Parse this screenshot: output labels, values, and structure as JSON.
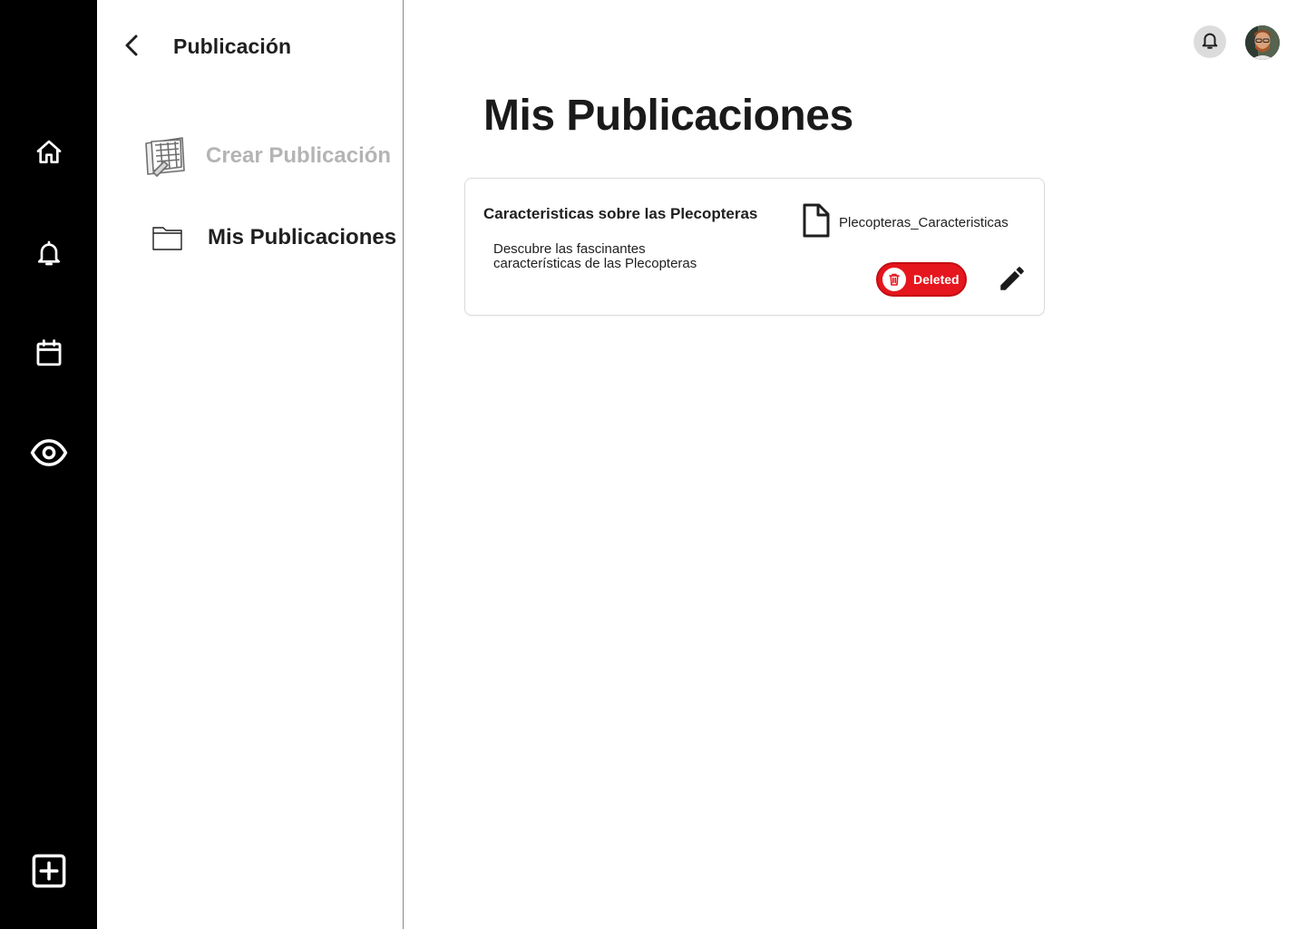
{
  "rail": {
    "items": [
      {
        "icon": "home-icon"
      },
      {
        "icon": "bell-icon"
      },
      {
        "icon": "calendar-icon"
      },
      {
        "icon": "eye-icon"
      }
    ],
    "add_icon": "plus-square-icon"
  },
  "panel": {
    "title": "Publicación",
    "nav": [
      {
        "label": "Crear Publicación",
        "icon": "create-publication-icon",
        "active": false
      },
      {
        "label": "Mis Publicaciones",
        "icon": "folder-icon",
        "active": true
      }
    ]
  },
  "header": {
    "notification_icon": "bell-icon",
    "avatar_icon": "user-avatar"
  },
  "main": {
    "title": "Mis Publicaciones",
    "publications": [
      {
        "title": "Caracteristicas sobre las Plecopteras",
        "description_line1": "Descubre las fascinantes",
        "description_line2": "características de las Plecopteras",
        "file_name": "Plecopteras_Caracteristicas",
        "status_label": "Deleted"
      }
    ]
  },
  "colors": {
    "rail_bg": "#000000",
    "deleted_red": "#e5161d",
    "inactive_text": "#b4b4b4"
  }
}
